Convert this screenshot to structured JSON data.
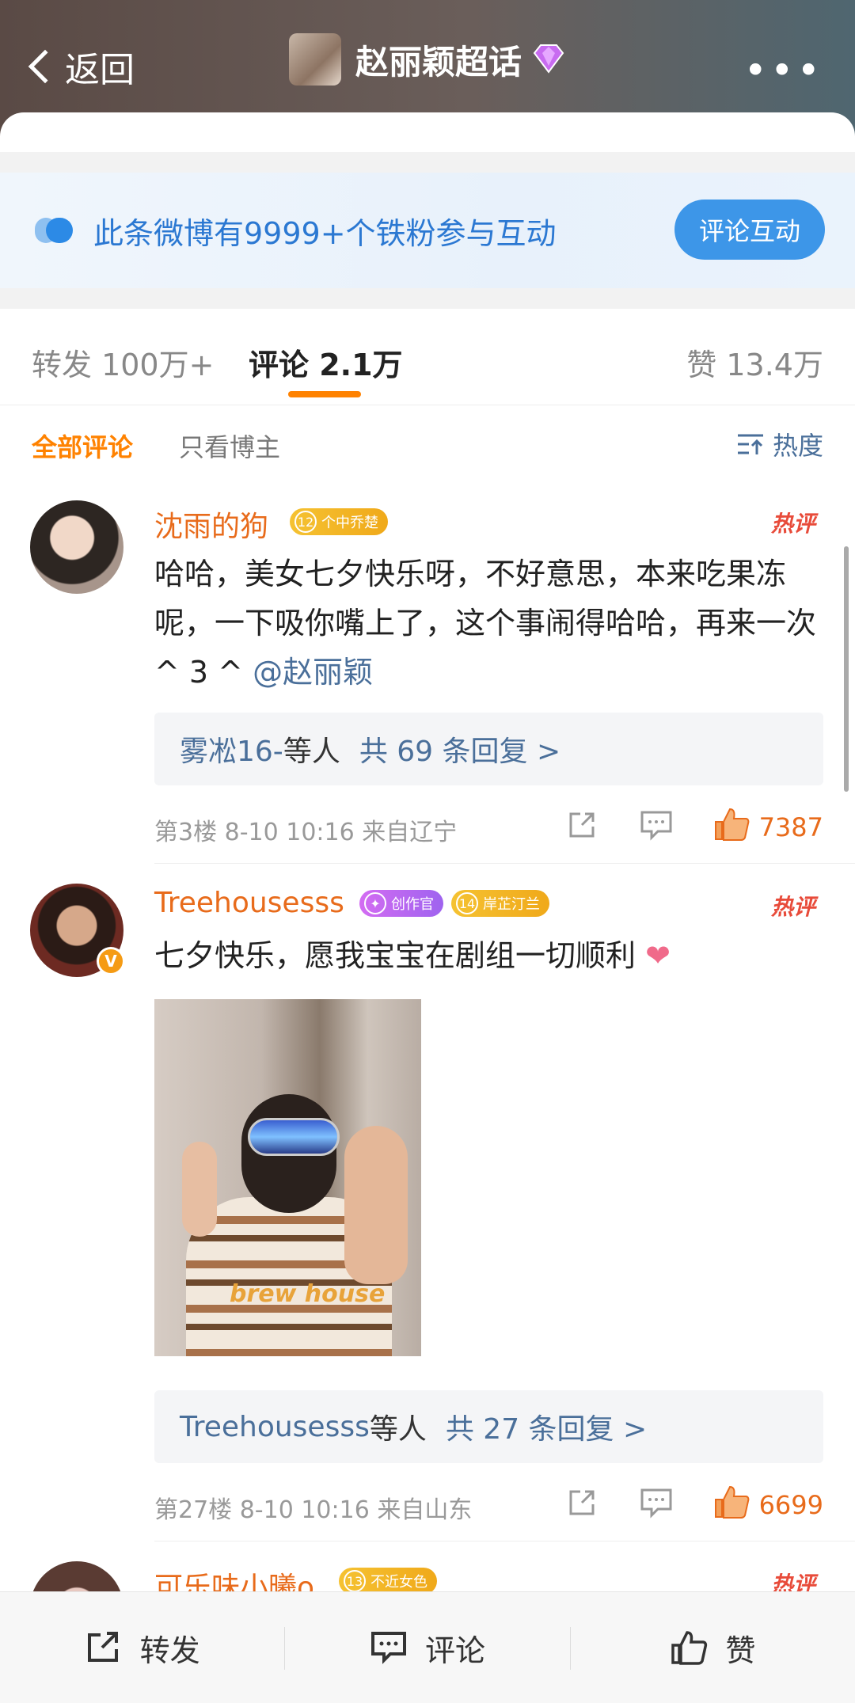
{
  "header": {
    "back_label": "返回",
    "title": "赵丽颖超话",
    "more_label": "•••"
  },
  "fan_banner": {
    "text": "此条微博有9999+个铁粉参与互动",
    "button": "评论互动"
  },
  "stats": {
    "repost": "转发 100万+",
    "comment": "评论 2.1万",
    "like": "赞 13.4万"
  },
  "filter": {
    "all": "全部评论",
    "owner_only": "只看博主",
    "sort": "热度"
  },
  "comments": [
    {
      "username": "沈雨的狗",
      "badge_num": "12",
      "badge_text": "个中乔楚",
      "hot": "热评",
      "text": "哈哈，美女七夕快乐呀，不好意思，本来吃果冻呢，一下吸你嘴上了，这个事闹得哈哈，再来一次 ^ 3 ^ ",
      "mention": "@赵丽颖",
      "reply_who": "雾凇16-",
      "reply_mid": "等人",
      "reply_count": "共 69 条回复 >",
      "meta": "第3楼  8-10 10:16  来自辽宁",
      "likes": "7387"
    },
    {
      "username": "Treehousesss",
      "badge1_text": "创作官",
      "badge_num": "14",
      "badge_text": "岸芷汀兰",
      "hot": "热评",
      "text": "七夕快乐，愿我宝宝在剧组一切顺利",
      "photo_text": "brew house",
      "reply_who": "Treehousesss",
      "reply_mid": "等人",
      "reply_count": "共 27 条回复 >",
      "meta": "第27楼  8-10 10:16  来自山东",
      "likes": "6699"
    },
    {
      "username": "可乐味小曦o",
      "badge_num": "13",
      "badge_text": "不近女色",
      "hot": "热评"
    }
  ],
  "bottom_bar": {
    "repost": "转发",
    "comment": "评论",
    "like": "赞"
  },
  "colors": {
    "accent_orange": "#ff8200",
    "link_blue": "#4a6f9a",
    "hot_red": "#e84b3a"
  }
}
